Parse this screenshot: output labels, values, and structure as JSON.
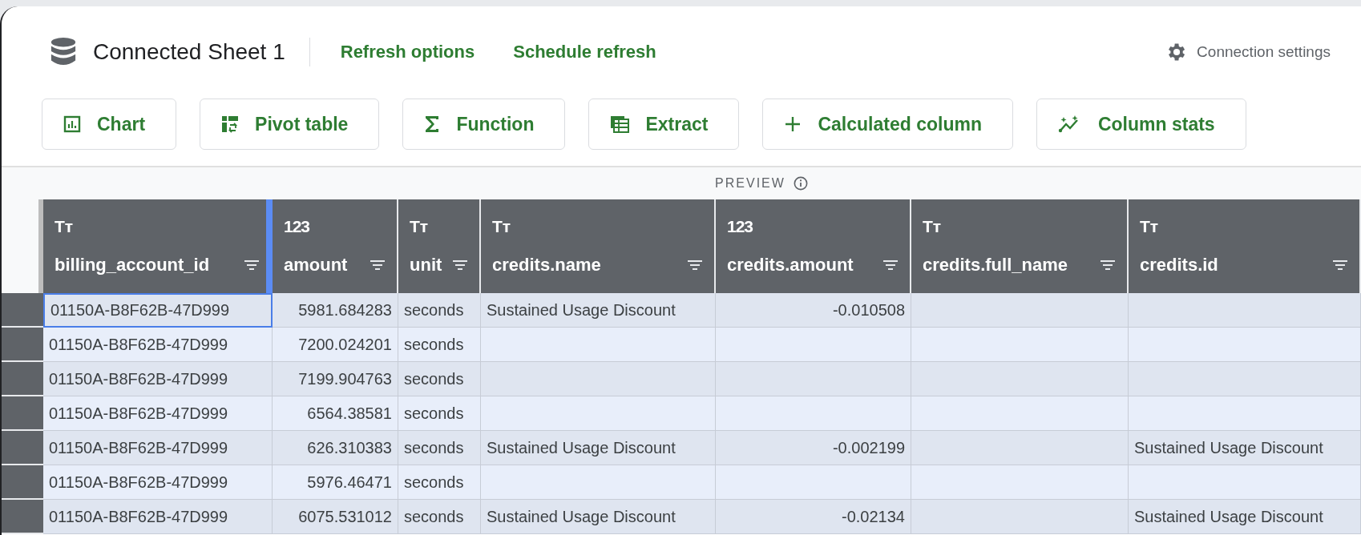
{
  "window": {
    "title": "Connected Sheet 1"
  },
  "header_links": [
    "Refresh options",
    "Schedule refresh"
  ],
  "connection_settings": "Connection settings",
  "toolbar": [
    {
      "label": "Chart",
      "kind": "chart"
    },
    {
      "label": "Pivot table",
      "kind": "pivot"
    },
    {
      "label": "Function",
      "kind": "function"
    },
    {
      "label": "Extract",
      "kind": "extract"
    },
    {
      "label": "Calculated column",
      "kind": "calculated"
    },
    {
      "label": "Column stats",
      "kind": "stats"
    }
  ],
  "preview": {
    "label": "PREVIEW"
  },
  "table": {
    "columns": [
      {
        "name": "billing_account_id",
        "kind": "text",
        "type_label": "Tт",
        "selected": true
      },
      {
        "name": "amount",
        "kind": "number",
        "type_label": "123",
        "selected": false
      },
      {
        "name": "unit",
        "kind": "text",
        "type_label": "Tт",
        "selected": false
      },
      {
        "name": "credits.name",
        "kind": "text",
        "type_label": "Tт",
        "selected": false
      },
      {
        "name": "credits.amount",
        "kind": "number",
        "type_label": "123",
        "selected": false
      },
      {
        "name": "credits.full_name",
        "kind": "text",
        "type_label": "Tт",
        "selected": false
      },
      {
        "name": "credits.id",
        "kind": "text",
        "type_label": "Tт",
        "selected": false
      }
    ],
    "rows": [
      {
        "selected": true,
        "cells": [
          "01150A-B8F62B-47D999",
          "5981.684283",
          "seconds",
          "Sustained Usage Discount",
          "-0.010508",
          null,
          null
        ]
      },
      {
        "selected": false,
        "cells": [
          "01150A-B8F62B-47D999",
          "7200.024201",
          "seconds",
          null,
          null,
          null,
          null
        ]
      },
      {
        "selected": false,
        "cells": [
          "01150A-B8F62B-47D999",
          "7199.904763",
          "seconds",
          null,
          null,
          null,
          null
        ]
      },
      {
        "selected": false,
        "cells": [
          "01150A-B8F62B-47D999",
          "6564.38581",
          "seconds",
          null,
          null,
          null,
          null
        ]
      },
      {
        "selected": false,
        "cells": [
          "01150A-B8F62B-47D999",
          "626.310383",
          "seconds",
          "Sustained Usage Discount",
          "-0.002199",
          null,
          "Sustained Usage Discount"
        ]
      },
      {
        "selected": false,
        "cells": [
          "01150A-B8F62B-47D999",
          "5976.46471",
          "seconds",
          null,
          null,
          null,
          null
        ]
      },
      {
        "selected": false,
        "cells": [
          "01150A-B8F62B-47D999",
          "6075.531012",
          "seconds",
          "Sustained Usage Discount",
          "-0.02134",
          null,
          "Sustained Usage Discount"
        ]
      }
    ]
  }
}
